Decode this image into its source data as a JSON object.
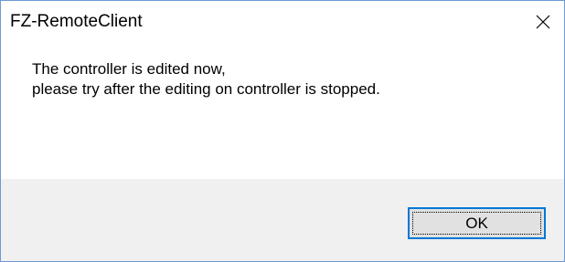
{
  "window": {
    "title": "FZ-RemoteClient",
    "close_icon": "close-icon"
  },
  "message": {
    "line1": "The controller is edited now,",
    "line2": "please try after the editing on controller is stopped."
  },
  "buttons": {
    "ok_label": "OK"
  },
  "colors": {
    "window_border": "#6e9bd2",
    "footer_background": "#f0f0f0",
    "button_background": "#e1e1e1",
    "button_focus_border": "#0078d7"
  }
}
